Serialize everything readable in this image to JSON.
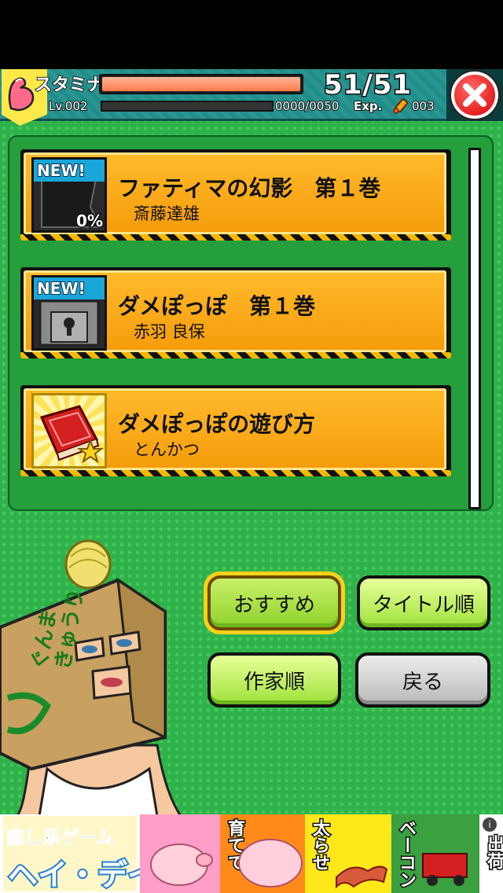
{
  "status": {
    "stamina_label": "スタミナ",
    "stamina_value": "51/51",
    "stamina_fraction": 1.0,
    "level": "Lv.002",
    "exp_value": "0000/0050",
    "exp_label": "Exp.",
    "exp_fraction": 0.0,
    "item_count": "003"
  },
  "books": [
    {
      "title": "ファティマの幻影　第１巻",
      "author": "斎藤達雄",
      "badge": "NEW!",
      "progress": "0%",
      "thumb": "dark-cover"
    },
    {
      "title": "ダメぽっぽ　第１巻",
      "author": "赤羽 良保",
      "badge": "NEW!",
      "progress": "",
      "thumb": "locked-cover"
    },
    {
      "title": "ダメぽっぽの遊び方",
      "author": "とんかつ",
      "badge": "",
      "progress": "",
      "thumb": "red-book-star"
    }
  ],
  "sort_buttons": {
    "recommended": "おすすめ",
    "title_order": "タイトル順",
    "author_order": "作家順",
    "back": "戻る"
  },
  "character": {
    "box_text_1": "ぐんま",
    "box_text_2": "きゅうり"
  },
  "ad": {
    "subtitle": "癒し系ゲーム",
    "title": "ヘイ・デイ",
    "panel_1": "育てて",
    "panel_2": "太らせ",
    "panel_3": "ベーコン",
    "panel_4": "出荷",
    "info": "i"
  },
  "colors": {
    "background_green": "#2fb24a",
    "book_row_orange": "#f5a81a",
    "header_teal": "#1f8e8a",
    "close_red": "#dd0000"
  }
}
